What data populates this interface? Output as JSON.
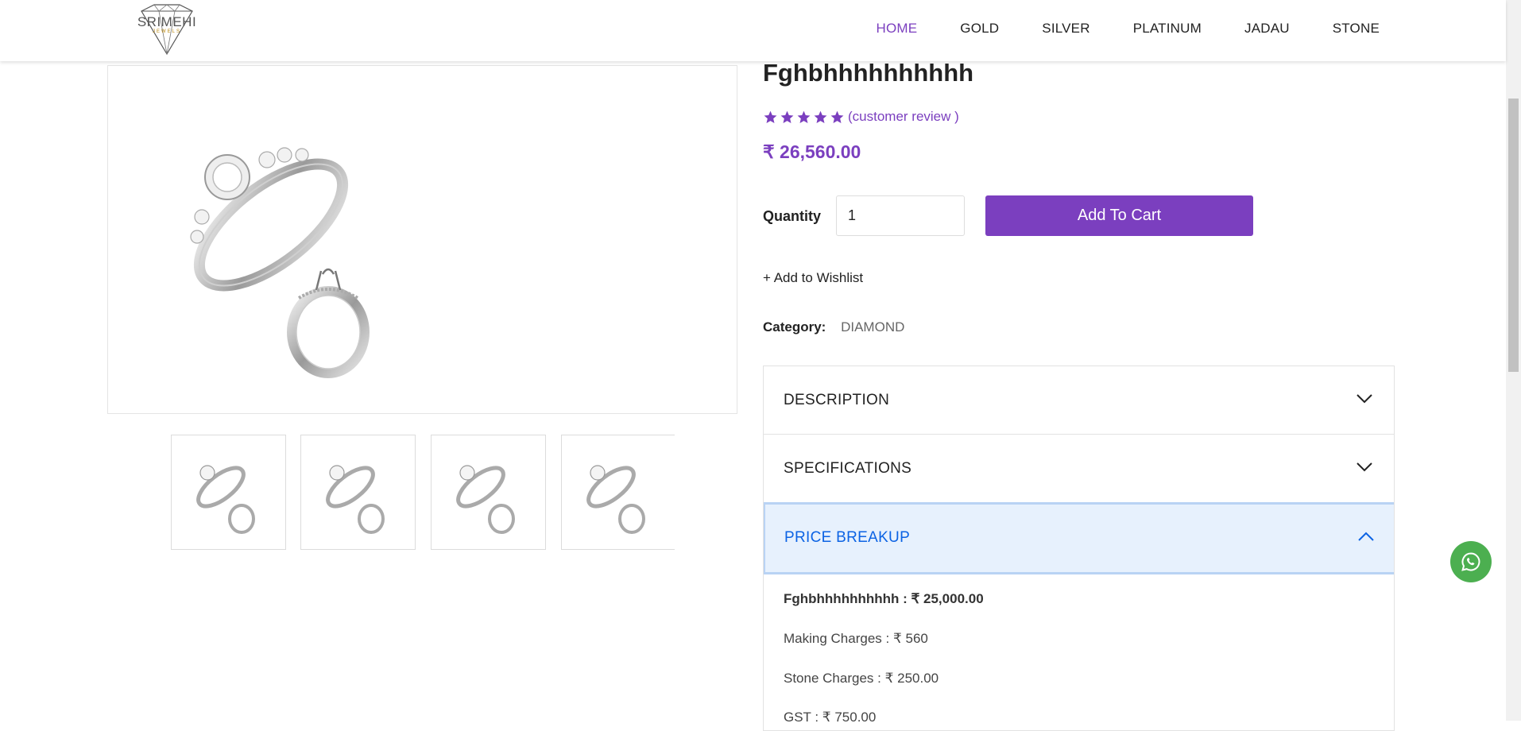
{
  "header": {
    "logo_text": "SRIMEHI",
    "logo_sub": "JEWELS",
    "nav": [
      {
        "label": "HOME",
        "active": true
      },
      {
        "label": "GOLD",
        "active": false
      },
      {
        "label": "SILVER",
        "active": false
      },
      {
        "label": "PLATINUM",
        "active": false
      },
      {
        "label": "JADAU",
        "active": false
      },
      {
        "label": "STONE",
        "active": false
      }
    ]
  },
  "product": {
    "title": "Fghbhhhhhhhhhh",
    "rating_stars": 5,
    "review_link": "(customer review )",
    "currency_symbol": "₹",
    "price": "26,560.00",
    "quantity_label": "Quantity",
    "quantity_value": "1",
    "add_to_cart_label": "Add To Cart",
    "wishlist_label": "+ Add to Wishlist",
    "category_label": "Category:",
    "category_value": "DIAMOND"
  },
  "accordion": {
    "sections": [
      {
        "label": "DESCRIPTION",
        "open": false
      },
      {
        "label": "SPECIFICATIONS",
        "open": false
      },
      {
        "label": "PRICE BREAKUP",
        "open": true
      }
    ],
    "price_breakup": [
      {
        "text": "Fghbhhhhhhhhhh : ₹ 25,000.00",
        "bold": true
      },
      {
        "text": "Making Charges : ₹ 560",
        "bold": false
      },
      {
        "text": "Stone Charges : ₹ 250.00",
        "bold": false
      },
      {
        "text": "GST : ₹ 750.00",
        "bold": false
      }
    ]
  },
  "colors": {
    "accent": "#7b3fbf",
    "accordion_active_bg": "#e7f1fd",
    "accordion_active_text": "#0c63e4",
    "whatsapp": "#4caf50"
  },
  "icons": {
    "logo": "diamond-logo-icon",
    "star": "star-icon",
    "chevron_down": "chevron-down-icon",
    "chevron_up": "chevron-up-icon",
    "whatsapp": "whatsapp-icon"
  }
}
